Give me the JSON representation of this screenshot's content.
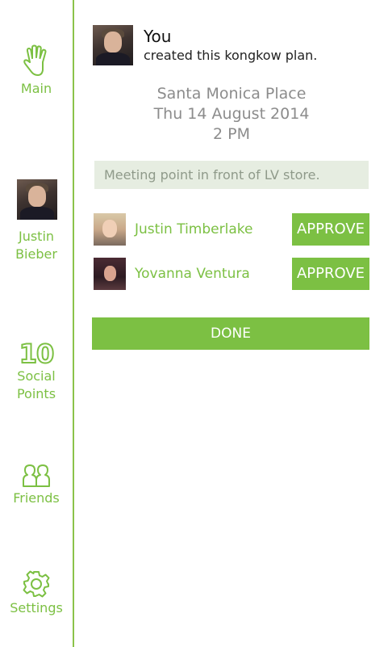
{
  "sidebar": {
    "main_label": "Main",
    "profile_label_line1": "Justin",
    "profile_label_line2": "Bieber",
    "points_value": "10",
    "points_label_line1": "Social",
    "points_label_line2": "Points",
    "friends_label": "Friends",
    "settings_label": "Settings",
    "icons": {
      "main": "hand-icon",
      "friends": "friends-icon",
      "settings": "gear-icon"
    },
    "accent_color": "#7cc043"
  },
  "plan": {
    "creator": "You",
    "created_text": "created this kongkow plan.",
    "location": "Santa Monica Place",
    "date": "Thu 14 August 2014",
    "time": "2 PM",
    "meeting_point": "Meeting point in front of LV store."
  },
  "participants": [
    {
      "name": "Justin Timberlake",
      "action_label": "APPROVE"
    },
    {
      "name": "Yovanna Ventura",
      "action_label": "APPROVE"
    }
  ],
  "done_label": "DONE"
}
